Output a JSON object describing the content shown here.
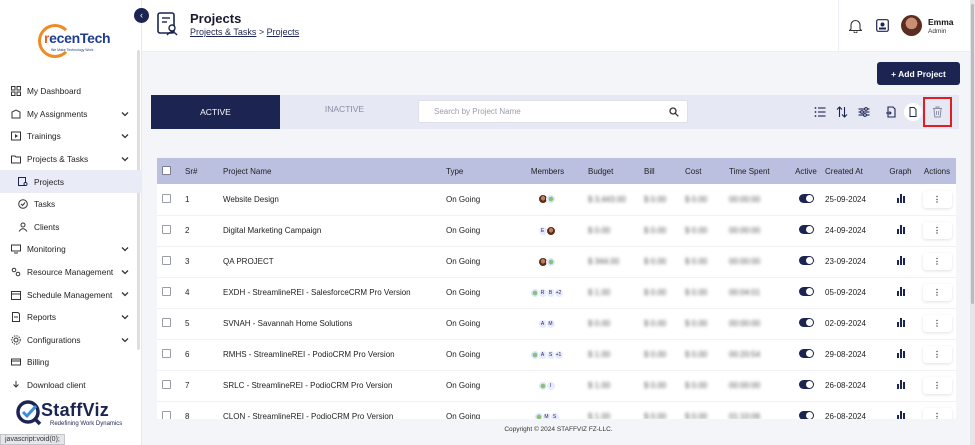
{
  "sidebar": {
    "logo": {
      "brand_r": "r",
      "brand_rest": "ecenTech",
      "tagline": "We Make Technology Work"
    },
    "items": [
      {
        "label": "My Dashboard",
        "icon": "grid-icon",
        "chevron": false
      },
      {
        "label": "My Assignments",
        "icon": "assignment-icon",
        "chevron": true
      },
      {
        "label": "Trainings",
        "icon": "play-icon",
        "chevron": true
      },
      {
        "label": "Projects & Tasks",
        "icon": "folder-icon",
        "chevron": true
      },
      {
        "label": "Projects",
        "icon": "project-icon",
        "chevron": false,
        "sub": true,
        "active": true
      },
      {
        "label": "Tasks",
        "icon": "check-circle-icon",
        "chevron": false,
        "sub": true
      },
      {
        "label": "Clients",
        "icon": "person-icon",
        "chevron": false,
        "sub": true
      },
      {
        "label": "Monitoring",
        "icon": "monitor-icon",
        "chevron": true
      },
      {
        "label": "Resource Management",
        "icon": "resource-icon",
        "chevron": true
      },
      {
        "label": "Schedule Management",
        "icon": "calendar-icon",
        "chevron": true
      },
      {
        "label": "Reports",
        "icon": "report-icon",
        "chevron": true
      },
      {
        "label": "Configurations",
        "icon": "settings-icon",
        "chevron": true
      },
      {
        "label": "Billing",
        "icon": "billing-icon",
        "chevron": false
      },
      {
        "label": "Download client",
        "icon": "download-icon",
        "chevron": false
      }
    ],
    "staffviz": {
      "name": "StaffViz",
      "tagline": "Redefining Work Dynamics"
    }
  },
  "status_bar": "javascript:void(0);",
  "header": {
    "title": "Projects",
    "breadcrumb_parent": "Projects & Tasks",
    "breadcrumb_sep": ">",
    "breadcrumb_current": "Projects",
    "user_name": "Emma",
    "user_role": "Admin"
  },
  "add_button": "+ Add Project",
  "tabs": {
    "active": "ACTIVE",
    "inactive": "INACTIVE"
  },
  "search": {
    "placeholder": "Search by Project Name",
    "value": ""
  },
  "table": {
    "headers": [
      "",
      "Sr#",
      "Project Name",
      "Type",
      "Members",
      "Budget",
      "Bill",
      "Cost",
      "Time Spent",
      "Active",
      "Created At",
      "Graph",
      "Actions"
    ],
    "rows": [
      {
        "sr": "1",
        "name": "Website Design",
        "type": "On Going",
        "members": [
          "photo",
          "green"
        ],
        "budget": "$ 3,443.00",
        "bill": "$ 0.00",
        "cost": "$ 0.00",
        "time": "00:00:00",
        "created": "25-09-2024"
      },
      {
        "sr": "2",
        "name": "Digital Marketing Campaign",
        "type": "On Going",
        "members": [
          "E",
          "photo"
        ],
        "budget": "$ 0.00",
        "bill": "$ 0.00",
        "cost": "$ 0.00",
        "time": "00:00:00",
        "created": "24-09-2024"
      },
      {
        "sr": "3",
        "name": "QA PROJECT",
        "type": "On Going",
        "members": [
          "photo",
          "green"
        ],
        "budget": "$ 344.00",
        "bill": "$ 0.00",
        "cost": "$ 0.00",
        "time": "00:00:00",
        "created": "23-09-2024"
      },
      {
        "sr": "4",
        "name": "EXDH - StreamlineREI - SalesforceCRM Pro Version",
        "type": "On Going",
        "members": [
          "green",
          "R",
          "B",
          "+2"
        ],
        "budget": "$ 1.00",
        "bill": "$ 0.00",
        "cost": "$ 0.00",
        "time": "00:04:01",
        "created": "05-09-2024"
      },
      {
        "sr": "5",
        "name": "SVNAH - Savannah Home Solutions",
        "type": "On Going",
        "members": [
          "A",
          "M"
        ],
        "budget": "$ 0.00",
        "bill": "$ 0.00",
        "cost": "$ 0.00",
        "time": "00:00:00",
        "created": "02-09-2024"
      },
      {
        "sr": "6",
        "name": "RMHS - StreamlineREI - PodioCRM Pro Version",
        "type": "On Going",
        "members": [
          "green",
          "A",
          "S",
          "+1"
        ],
        "budget": "$ 1.00",
        "bill": "$ 0.00",
        "cost": "$ 0.00",
        "time": "00:20:54",
        "created": "29-08-2024"
      },
      {
        "sr": "7",
        "name": "SRLC - StreamlineREI - PodioCRM Pro Version",
        "type": "On Going",
        "members": [
          "green",
          "I"
        ],
        "budget": "$ 1.00",
        "bill": "$ 0.00",
        "cost": "$ 0.00",
        "time": "00:00:00",
        "created": "26-08-2024"
      },
      {
        "sr": "8",
        "name": "CLON - StreamlineREI - PodioCRM Pro Version",
        "type": "On Going",
        "members": [
          "green",
          "M",
          "S"
        ],
        "budget": "$ 1.00",
        "bill": "$ 0.00",
        "cost": "$ 0.00",
        "time": "01:10:06",
        "created": "26-08-2024"
      }
    ]
  },
  "footer": "Copyright © 2024 STAFFVIZ FZ-LLC.",
  "colors": {
    "navy": "#1c2452",
    "highlight": "#e31b23",
    "header_row": "#bcc0e0"
  }
}
